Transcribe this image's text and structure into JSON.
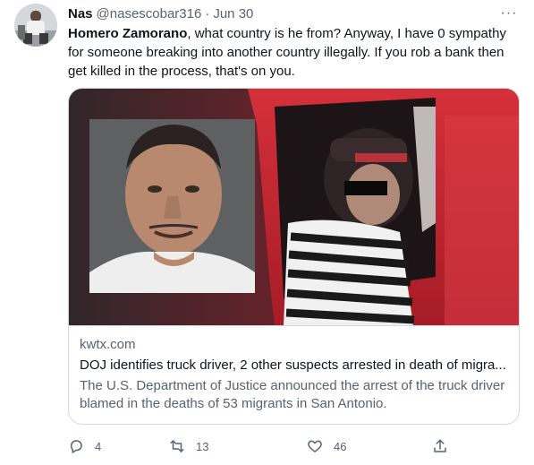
{
  "tweet": {
    "author_name": "Nas",
    "author_handle": "@nasescobar316",
    "separator": "·",
    "date": "Jun 30",
    "more_label": "···",
    "text_bold": "Homero Zamorano",
    "text_rest": ", what country is he from? Anyway, I have 0 sympathy for someone breaking into another country illegally. If you rob a bank then get killed in the process, that's on you."
  },
  "card": {
    "domain": "kwtx.com",
    "title": "DOJ identifies truck driver, 2 other suspects arrested in death of migra...",
    "description": "The U.S. Department of Justice announced the arrest of the truck driver blamed in the deaths of 53 migrants in San Antonio."
  },
  "actions": {
    "replies": "4",
    "retweets": "13",
    "likes": "46"
  },
  "icons": {
    "reply": "reply-icon",
    "retweet": "retweet-icon",
    "like": "heart-icon",
    "share": "share-icon",
    "more": "more-icon"
  },
  "colors": {
    "text_primary": "#0f1419",
    "text_secondary": "#536471",
    "border": "#cfd9de",
    "truck_red": "#c8232f"
  }
}
